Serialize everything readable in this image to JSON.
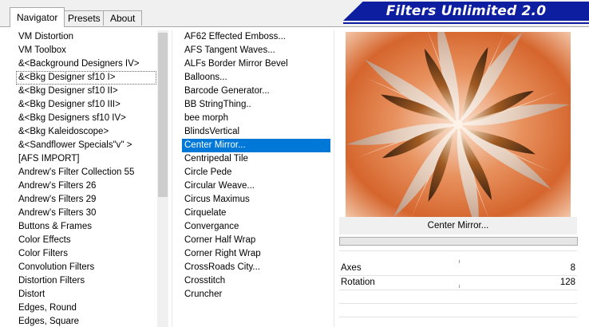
{
  "tabs": [
    {
      "label": "Navigator",
      "active": true
    },
    {
      "label": "Presets",
      "active": false
    },
    {
      "label": "About",
      "active": false
    }
  ],
  "banner": {
    "title": "Filters Unlimited 2.0"
  },
  "categories": [
    "VM Distortion",
    "VM Toolbox",
    "&<Background Designers IV>",
    "&<Bkg Designer sf10 I>",
    "&<Bkg Designer sf10 II>",
    "&<Bkg Designer sf10 III>",
    "&<Bkg Designers sf10 IV>",
    "&<Bkg Kaleidoscope>",
    "&<Sandflower Specials\"v\" >",
    "[AFS IMPORT]",
    "Andrew's Filter Collection 55",
    "Andrew's Filters 26",
    "Andrew's Filters 29",
    "Andrew's Filters 30",
    "Buttons & Frames",
    "Color Effects",
    "Color Filters",
    "Convolution Filters",
    "Distortion Filters",
    "Distort",
    "Edges, Round",
    "Edges, Square"
  ],
  "selected_category": "&<Bkg Designer sf10 I>",
  "filters": [
    "AF62 Effected Emboss...",
    "AFS Tangent Waves...",
    "ALFs Border Mirror Bevel",
    "Balloons...",
    "Barcode Generator...",
    "BB StringThing..",
    "bee morph",
    "BlindsVertical",
    "Center Mirror...",
    "Centripedal Tile",
    "Circle Pede",
    "Circular Weave...",
    "Circus Maximus",
    "Cirquelate",
    "Convergance",
    "Corner Half Wrap",
    "Corner Right Wrap",
    "CrossRoads City...",
    "Crosstitch",
    "Cruncher"
  ],
  "selected_filter": "Center Mirror...",
  "preview": {
    "filter_name": "Center Mirror..."
  },
  "params": [
    {
      "label": "Axes",
      "value": "8"
    },
    {
      "label": "Rotation",
      "value": "128"
    }
  ],
  "colors": {
    "selection": "#0078d7",
    "banner": "#0d1fa0",
    "preview_base": "#d9743f"
  }
}
